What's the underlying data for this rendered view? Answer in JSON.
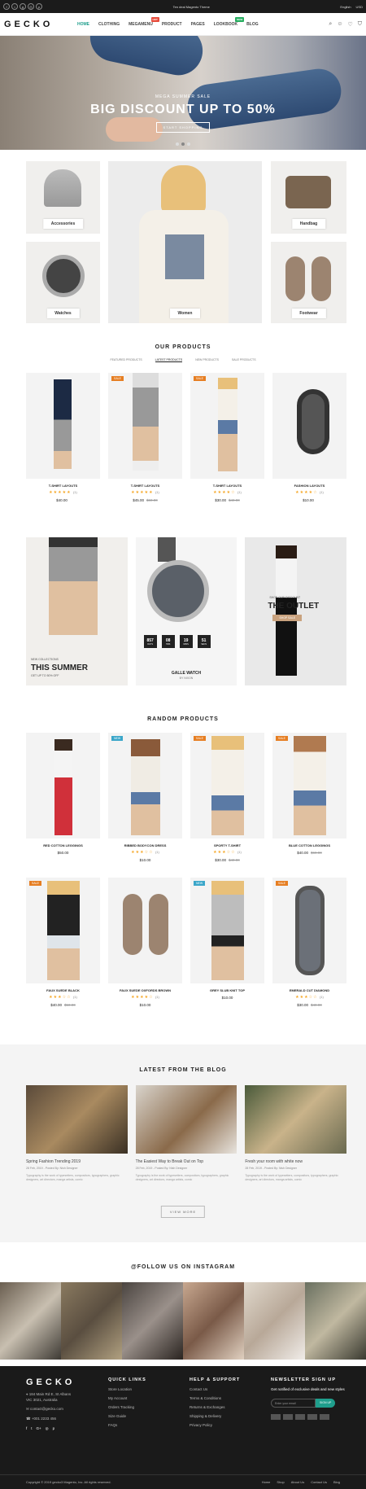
{
  "topbar": {
    "promo": "Ten deal Magento Theme",
    "language": "English",
    "currency": "USD"
  },
  "header": {
    "logo": "GECKO",
    "nav": [
      {
        "label": "HOME",
        "active": true
      },
      {
        "label": "CLOTHING"
      },
      {
        "label": "MEGAMENU",
        "badge": "HOT"
      },
      {
        "label": "PRODUCT"
      },
      {
        "label": "PAGES"
      },
      {
        "label": "LOOKBOOK",
        "badge": "NEW"
      },
      {
        "label": "BLOG"
      }
    ]
  },
  "hero": {
    "subtitle": "MEGA SUMMER SALE",
    "title": "BIG DISCOUNT UP TO 50%",
    "button": "START SHOPPING"
  },
  "categories": {
    "accessories": "Accessories",
    "handbag": "Handbag",
    "watches": "Watches",
    "women": "Women",
    "footwear": "Footwear"
  },
  "our_products": {
    "title": "OUR PRODUCTS",
    "tabs": [
      "FEATURED PRODUCTS",
      "LATEST PRODUCTS",
      "NEW PRODUCTS",
      "SALE PRODUCTS"
    ],
    "items": [
      {
        "name": "T-SHIRT LAYOUTS",
        "stars": "★★★★★",
        "count": "(1)",
        "price": "$40.00",
        "old": ""
      },
      {
        "name": "T-SHIRT LAYOUTS",
        "stars": "★★★★★",
        "count": "(1)",
        "price": "$45.00",
        "old": "$60.00",
        "tag": "SALE"
      },
      {
        "name": "T-SHIRT LAYOUTS",
        "stars": "★★★★☆",
        "count": "(1)",
        "price": "$30.00",
        "old": "$40.00",
        "tag": "SALE"
      },
      {
        "name": "FASHION LAYOUTS",
        "stars": "★★★★☆",
        "count": "(1)",
        "price": "$10.00",
        "old": ""
      }
    ]
  },
  "banners": {
    "summer_sub": "NEW COLLECTIONS",
    "summer_title": "THIS SUMMER",
    "summer_note": "GET UP TO 50% OFF",
    "watch_title": "GALLE WATCH",
    "watch_sub": "BY NIXON",
    "timer": [
      "857",
      "08",
      "19",
      "51"
    ],
    "timer_units": [
      "DAYS",
      "HRS",
      "MINS",
      "SECS"
    ],
    "outlet_sub": "SHOP OUR DISCOUNT",
    "outlet_title": "THE OUTLET",
    "outlet_btn": "SHOP SALE"
  },
  "random_products": {
    "title": "RANDOM PRODUCTS",
    "items": [
      {
        "name": "RED COTTON LEGGINGS",
        "stars": "",
        "count": "",
        "price": "$50.00",
        "old": ""
      },
      {
        "name": "RIBBED BODYCON DRESS",
        "stars": "★★★☆☆",
        "count": "(1)",
        "price": "$10.00",
        "old": "",
        "tag": "NEW"
      },
      {
        "name": "SPORTY T-SHIRT",
        "stars": "★★★☆☆",
        "count": "(1)",
        "price": "$30.00",
        "old": "$40.00",
        "tag": "SALE"
      },
      {
        "name": "BLUE COTTON LEGGINGS",
        "stars": "",
        "count": "",
        "price": "$40.00",
        "old": "$60.00",
        "tag": "SALE"
      },
      {
        "name": "FAUX SUEDE BLACK",
        "stars": "★★★☆☆",
        "count": "(1)",
        "price": "$40.00",
        "old": "$50.00",
        "tag": "SALE"
      },
      {
        "name": "FAUX SUEDE OXFORDS BROWN",
        "stars": "★★★★☆",
        "count": "(1)",
        "price": "$10.00",
        "old": ""
      },
      {
        "name": "GREY SLUB KNIT TOP",
        "stars": "",
        "count": "",
        "price": "$10.00",
        "old": "",
        "tag": "NEW"
      },
      {
        "name": "EMERALD CUT DIAMOND",
        "stars": "★★★☆☆",
        "count": "(1)",
        "price": "$30.00",
        "old": "$40.00",
        "tag": "SALE"
      }
    ]
  },
  "blog": {
    "title": "LATEST FROM THE BLOG",
    "view_more": "VIEW MORE",
    "posts": [
      {
        "title": "Spring Fashion Trending 2019",
        "meta": "28 Feb, 2019  -  Posted By: Nish Designer",
        "excerpt": "Typography is the work of typesetters, compositors, typographers, graphic designers, art directors, manga artists, comic"
      },
      {
        "title": "The Easiest Way to Break Out on Top",
        "meta": "28 Feb, 2019  -  Posted By: Nish Designer",
        "excerpt": "Typography is the work of typesetters, compositors, typographers, graphic designers, art directors, manga artists, comic"
      },
      {
        "title": "Fresh your room with white now",
        "meta": "28 Feb, 2019  -  Posted By: Nish Designer",
        "excerpt": "Typography is the work of typesetters, compositors, typographers, graphic designers, art directors, manga artists, comic"
      }
    ]
  },
  "instagram": {
    "title": "@FOLLOW US ON INSTAGRAM"
  },
  "footer": {
    "logo": "GECKO",
    "address": "184 Main Rd E, St Albans",
    "address2": "VIC 3021, Australia",
    "email": "contact@gecko.com",
    "phone": "+001 2233 456",
    "quick_title": "QUICK LINKS",
    "quick": [
      "Store Location",
      "My Account",
      "Orders Tracking",
      "Size Guide",
      "FAQs"
    ],
    "help_title": "HELP & SUPPORT",
    "help": [
      "Contact Us",
      "Terms & Conditions",
      "Returns & Exchanges",
      "Shipping & Delivery",
      "Privacy Policy"
    ],
    "news_title": "NEWSLETTER SIGN UP",
    "news_text": "Get notified of exclusive deals and new styles",
    "news_placeholder": "Enter your email",
    "news_btn": "SIGN UP",
    "copyright": "Copyright © 2019 gecko3 Magento, Inc. All rights reserved.",
    "bottom_links": [
      "Home",
      "Shop",
      "About Us",
      "Contact Us",
      "Blog"
    ]
  }
}
